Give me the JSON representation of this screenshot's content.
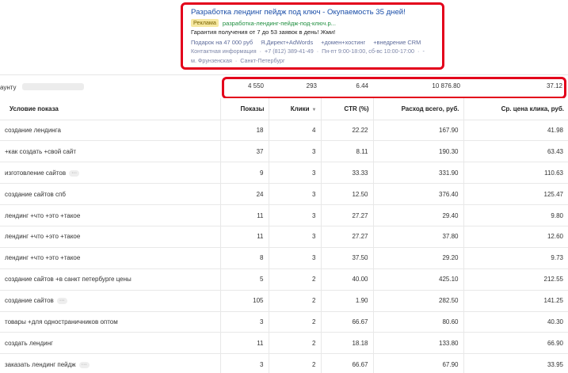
{
  "ad": {
    "title": "Разработка лендинг пейдж под ключ - Окупаемость 35 дней!",
    "badge": "Реклама",
    "display_url": "разработка-лендинг-пейдж-под-ключ.р...",
    "text": "Гарантия получения от 7 до 53 заявок в день! Жми!",
    "sitelinks": [
      "Подарок на 47 000 руб",
      "Я.Директ+AdWords",
      "+домен+хостинг",
      "+внедрение CRM"
    ],
    "contacts_line1": [
      "Контактная информация",
      "+7 (812) 389-41-49",
      "Пн-пт 9:00-18:00, сб-вс 10:00-17:00",
      "-"
    ],
    "contacts_line2": [
      "м. Фрунзенская",
      "Санкт-Петербург"
    ]
  },
  "totals": {
    "label": "аунту",
    "shows": "4 550",
    "clicks": "293",
    "ctr": "6.44",
    "cost": "10 876.80",
    "avg_cpc": "37.12"
  },
  "table": {
    "headers": {
      "condition": "Условие показа",
      "shows": "Показы",
      "clicks": "Клики",
      "ctr": "CTR (%)",
      "cost": "Расход всего, руб.",
      "avg_cpc": "Ср. цена клика, руб."
    },
    "sort_icon": "sort-down-icon",
    "rows": [
      {
        "condition": "создание лендинга",
        "dots": false,
        "shows": "18",
        "clicks": "4",
        "ctr": "22.22",
        "cost": "167.90",
        "avg_cpc": "41.98"
      },
      {
        "condition": "+как создать +свой сайт",
        "dots": false,
        "shows": "37",
        "clicks": "3",
        "ctr": "8.11",
        "cost": "190.30",
        "avg_cpc": "63.43"
      },
      {
        "condition": "изготовление сайтов",
        "dots": true,
        "shows": "9",
        "clicks": "3",
        "ctr": "33.33",
        "cost": "331.90",
        "avg_cpc": "110.63"
      },
      {
        "condition": "создание сайтов спб",
        "dots": false,
        "shows": "24",
        "clicks": "3",
        "ctr": "12.50",
        "cost": "376.40",
        "avg_cpc": "125.47"
      },
      {
        "condition": "лендинг +что +это +такое",
        "dots": false,
        "shows": "11",
        "clicks": "3",
        "ctr": "27.27",
        "cost": "29.40",
        "avg_cpc": "9.80"
      },
      {
        "condition": "лендинг +что +это +такое",
        "dots": false,
        "shows": "11",
        "clicks": "3",
        "ctr": "27.27",
        "cost": "37.80",
        "avg_cpc": "12.60"
      },
      {
        "condition": "лендинг +что +это +такое",
        "dots": false,
        "shows": "8",
        "clicks": "3",
        "ctr": "37.50",
        "cost": "29.20",
        "avg_cpc": "9.73"
      },
      {
        "condition": "создание сайтов +в санкт петербурге цены",
        "dots": false,
        "shows": "5",
        "clicks": "2",
        "ctr": "40.00",
        "cost": "425.10",
        "avg_cpc": "212.55"
      },
      {
        "condition": "создание сайтов",
        "dots": true,
        "shows": "105",
        "clicks": "2",
        "ctr": "1.90",
        "cost": "282.50",
        "avg_cpc": "141.25"
      },
      {
        "condition": "товары +для одностраничников оптом",
        "dots": false,
        "shows": "3",
        "clicks": "2",
        "ctr": "66.67",
        "cost": "80.60",
        "avg_cpc": "40.30"
      },
      {
        "condition": "создать лендинг",
        "dots": false,
        "shows": "11",
        "clicks": "2",
        "ctr": "18.18",
        "cost": "133.80",
        "avg_cpc": "66.90"
      },
      {
        "condition": "заказать лендинг пейдж",
        "dots": true,
        "shows": "3",
        "clicks": "2",
        "ctr": "66.67",
        "cost": "67.90",
        "avg_cpc": "33.95"
      }
    ]
  },
  "colors": {
    "highlight_border": "#e3001b",
    "ad_title": "#1a4ea8",
    "ad_url": "#1e8e3e",
    "ad_badge_bg": "#f6e8a0"
  }
}
